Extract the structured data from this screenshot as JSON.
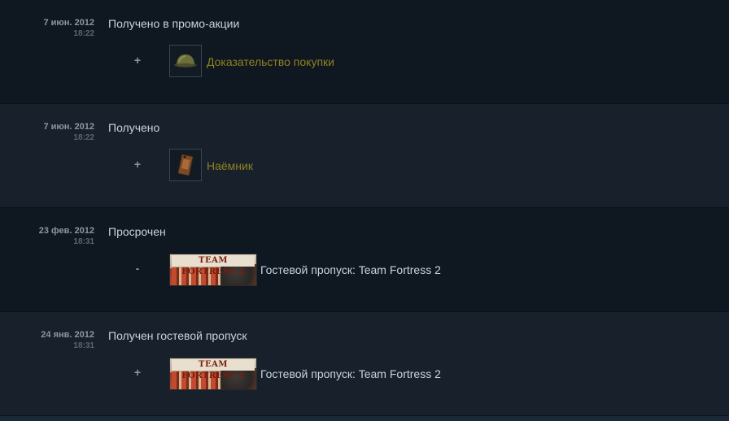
{
  "history": [
    {
      "date": "7 июн. 2012",
      "time": "18:22",
      "event": "Получено в промо-акции",
      "sign": "+",
      "item": {
        "name": "Доказательство покупки",
        "icon": "helmet-icon",
        "color": "#8d8322"
      }
    },
    {
      "date": "7 июн. 2012",
      "time": "18:22",
      "event": "Получено",
      "sign": "+",
      "item": {
        "name": "Наёмник",
        "icon": "tag-icon",
        "color": "#8d8322"
      }
    },
    {
      "date": "23 фев. 2012",
      "time": "18:31",
      "event": "Просрочен",
      "sign": "-",
      "item": {
        "name": "Гостевой пропуск: Team Fortress 2",
        "banner_text": "TEAM FORTRESS 2",
        "color": "#c6d4df"
      }
    },
    {
      "date": "24 янв. 2012",
      "time": "18:31",
      "event": "Получен гостевой пропуск",
      "sign": "+",
      "item": {
        "name": "Гостевой пропуск: Team Fortress 2",
        "banner_text": "TEAM FORTRESS 2",
        "color": "#c6d4df"
      }
    }
  ]
}
